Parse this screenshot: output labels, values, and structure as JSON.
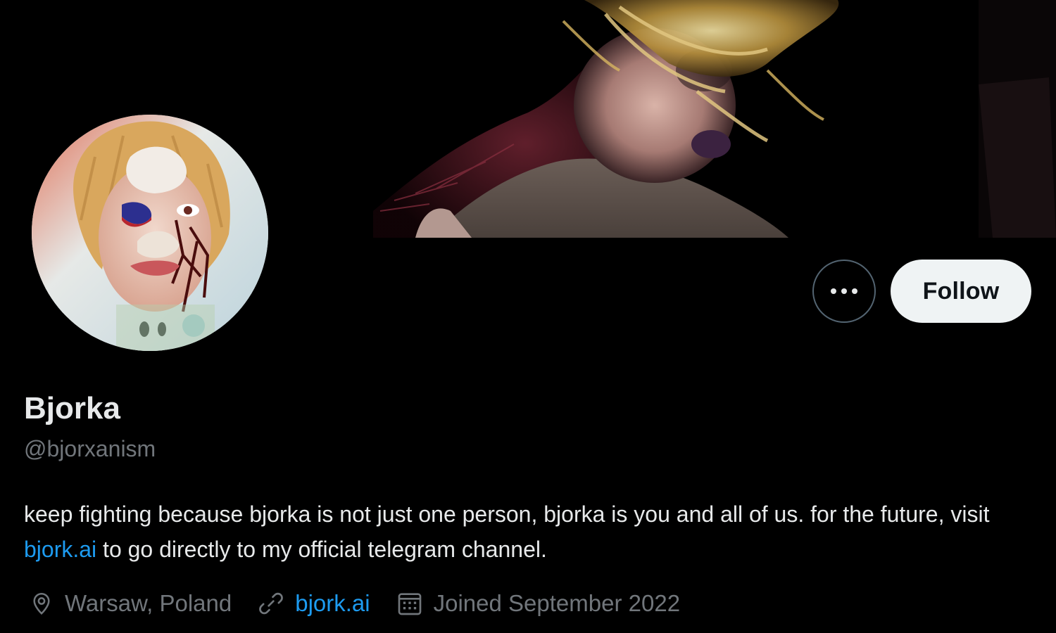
{
  "profile": {
    "display_name": "Bjorka",
    "handle": "@bjorxanism",
    "bio_before_link": "keep fighting because bjorka is not just one person, bjorka is you and all of us. for the future, visit",
    "bio_link": "bjork.ai",
    "bio_after_link": " to go directly to my official telegram channel.",
    "location": "Warsaw, Poland",
    "website": "bjork.ai",
    "joined": "Joined September 2022"
  },
  "actions": {
    "more_icon": "ellipsis-icon",
    "follow_label": "Follow"
  },
  "icons": {
    "location": "map-pin-icon",
    "website": "link-icon",
    "joined": "calendar-icon"
  },
  "colors": {
    "background": "#000000",
    "text_primary": "#e7e9ea",
    "text_secondary": "#71767b",
    "link": "#1d9bf0",
    "follow_bg": "#eff3f4"
  }
}
